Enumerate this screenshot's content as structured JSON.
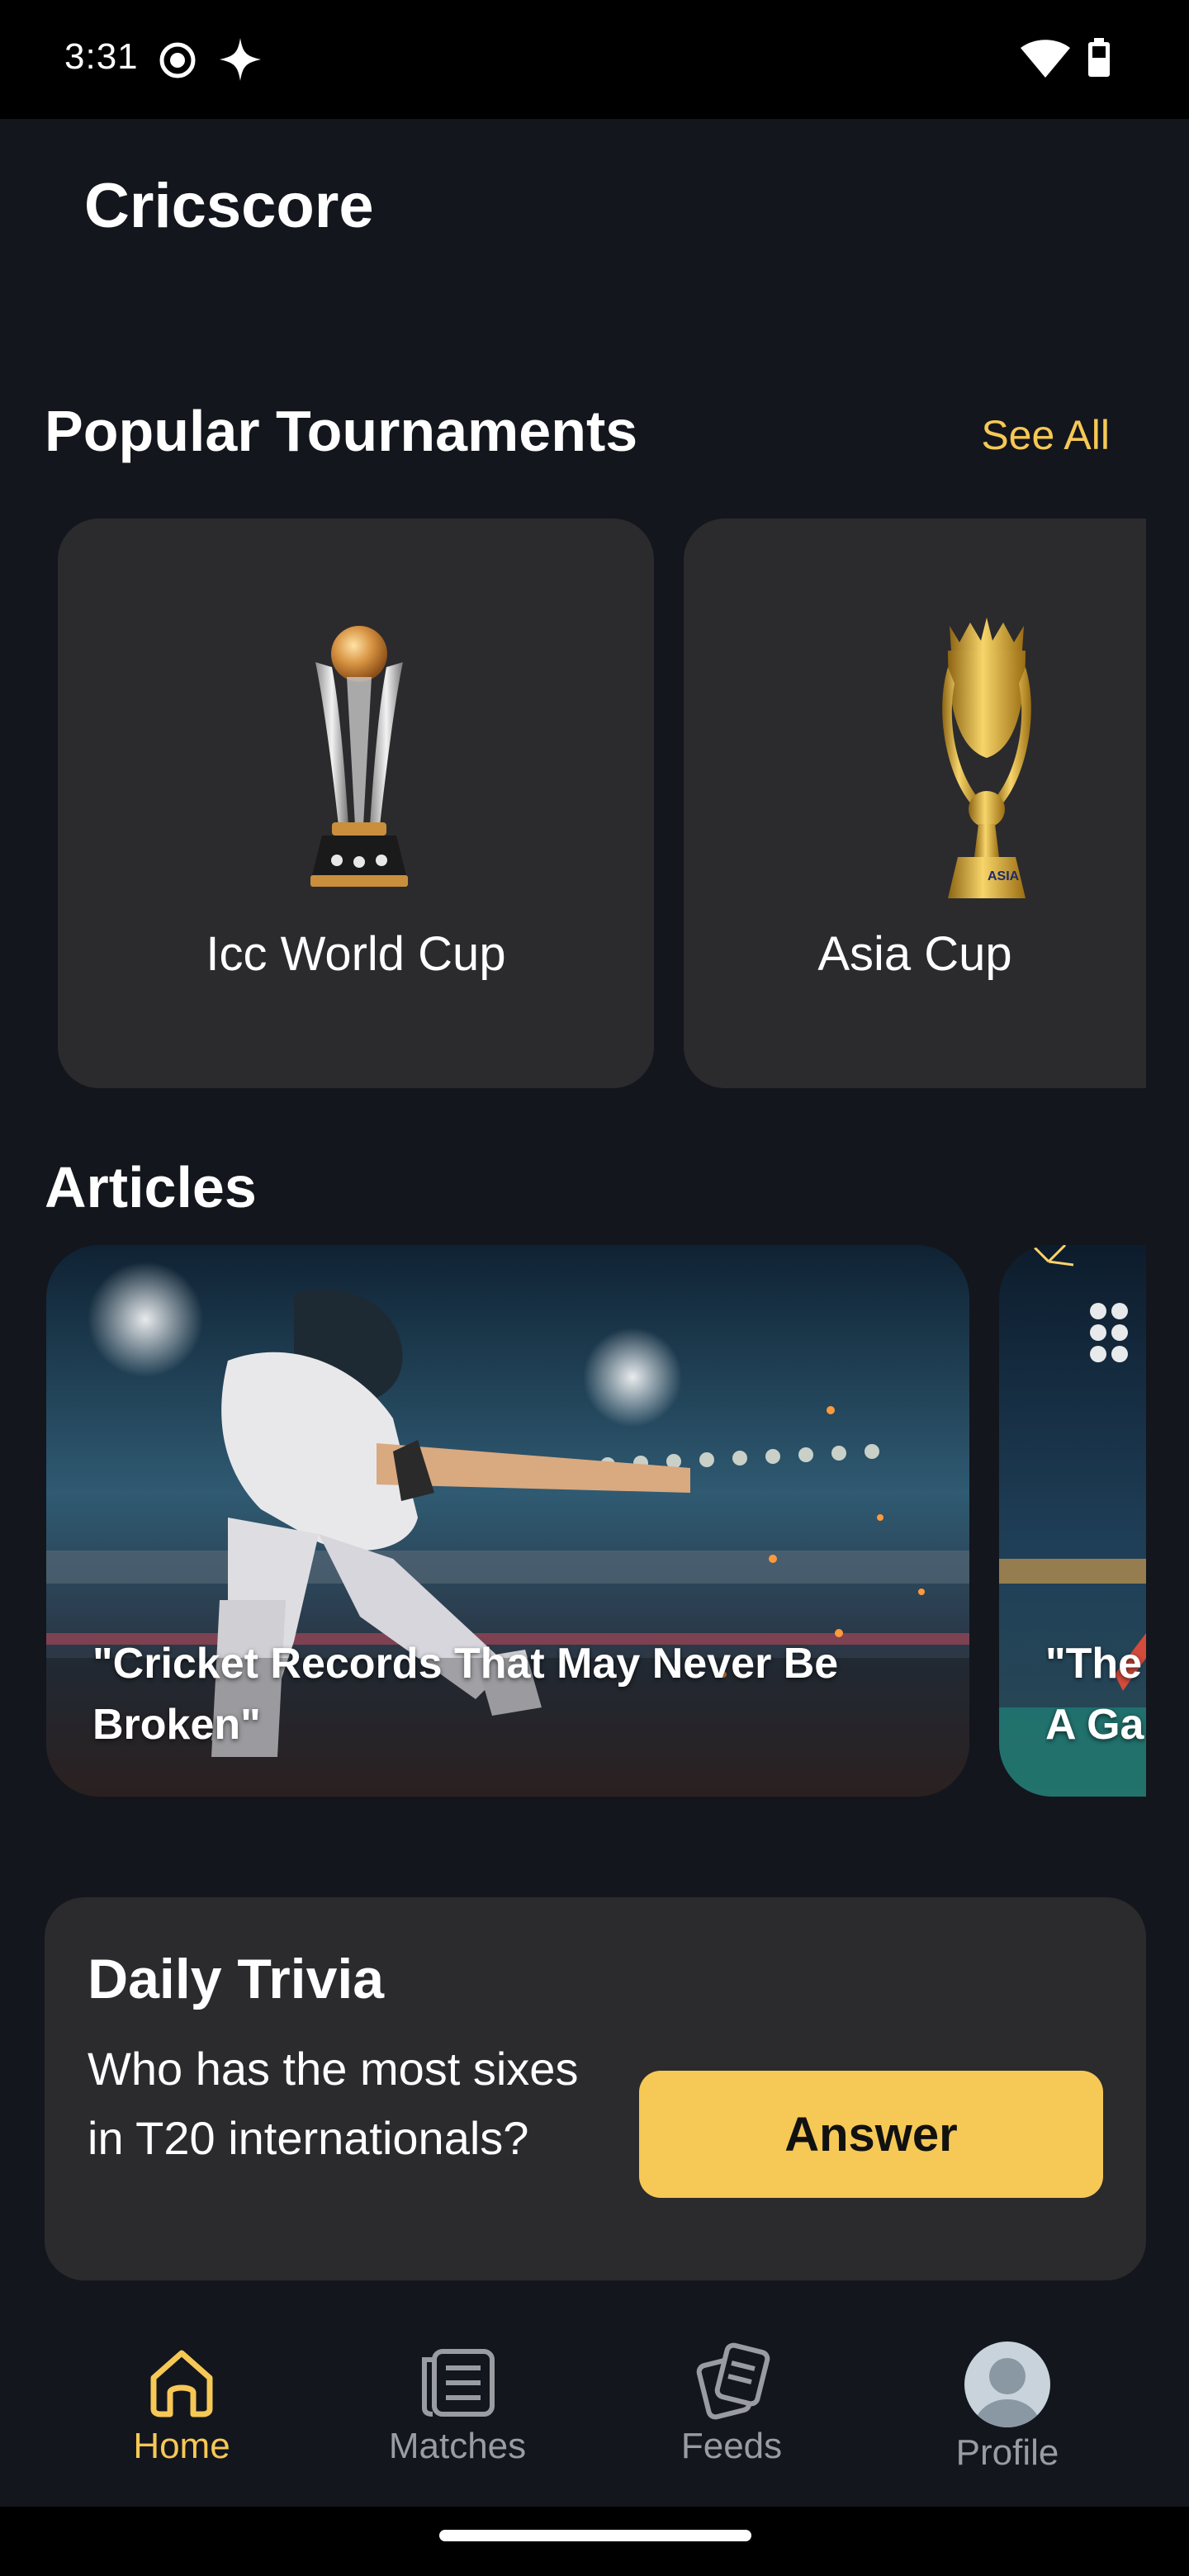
{
  "status_bar": {
    "time": "3:31"
  },
  "app": {
    "title": "Cricscore"
  },
  "tournaments": {
    "title": "Popular Tournaments",
    "see_all": "See All",
    "items": [
      {
        "name": "Icc World Cup"
      },
      {
        "name": "Asia Cup"
      }
    ]
  },
  "articles": {
    "title": "Articles",
    "items": [
      {
        "title": "\"Cricket Records That May Never Be Broken\""
      },
      {
        "title": "\"The\nA Ga"
      }
    ]
  },
  "trivia": {
    "title": "Daily Trivia",
    "question": "Who has the most sixes in T20 internationals?",
    "answer_label": "Answer"
  },
  "bottom_nav": {
    "items": [
      {
        "label": "Home",
        "icon": "home-icon",
        "active": true
      },
      {
        "label": "Matches",
        "icon": "matches-icon",
        "active": false
      },
      {
        "label": "Feeds",
        "icon": "feeds-icon",
        "active": false
      },
      {
        "label": "Profile",
        "icon": "avatar",
        "active": false
      }
    ]
  },
  "colors": {
    "background": "#13161d",
    "card": "#2b2b2d",
    "accent": "#f6c855",
    "inactive": "#9a9ca2"
  }
}
